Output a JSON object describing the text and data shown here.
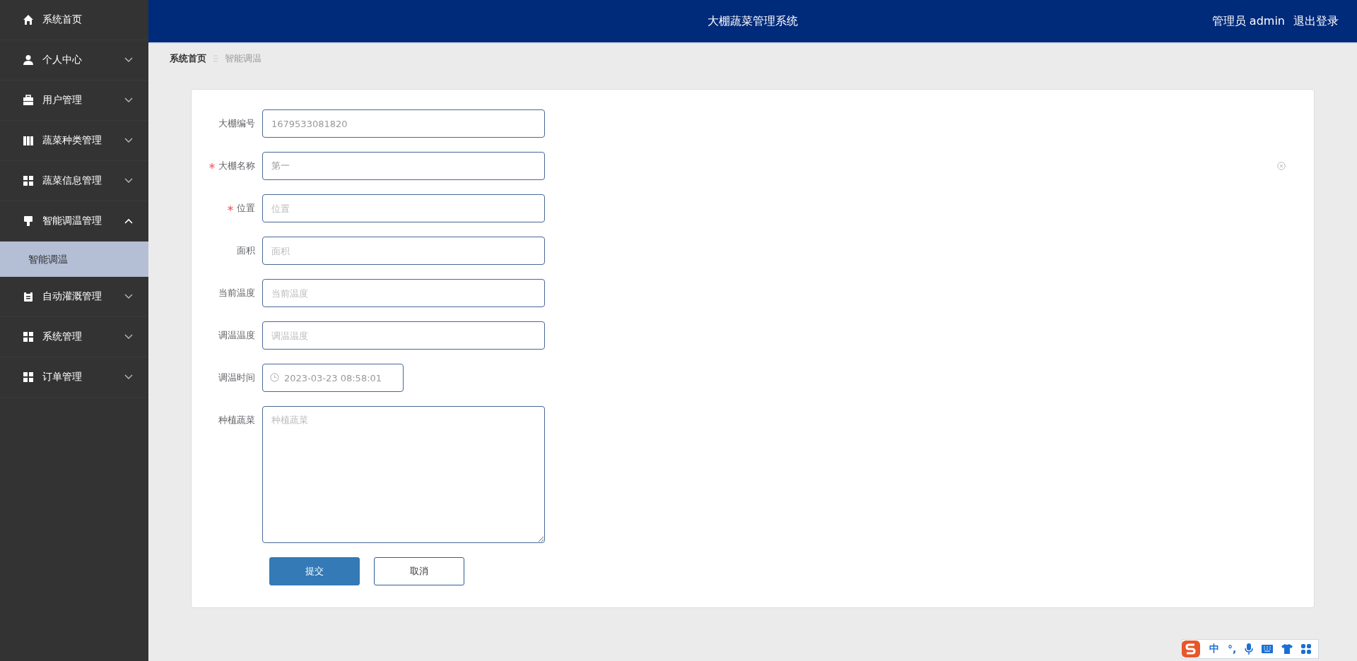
{
  "header": {
    "title": "大棚蔬菜管理系统",
    "user": "管理员 admin",
    "logout": "退出登录"
  },
  "sidebar": {
    "items": [
      {
        "label": "系统首页"
      },
      {
        "label": "个人中心",
        "expanded": false
      },
      {
        "label": "用户管理",
        "expanded": false
      },
      {
        "label": "蔬菜种类管理",
        "expanded": false
      },
      {
        "label": "蔬菜信息管理",
        "expanded": false
      },
      {
        "label": "智能调温管理",
        "expanded": true,
        "children": [
          {
            "label": "智能调温",
            "selected": true
          }
        ]
      },
      {
        "label": "自动灌溉管理",
        "expanded": false
      },
      {
        "label": "系统管理",
        "expanded": false
      },
      {
        "label": "订单管理",
        "expanded": false
      }
    ]
  },
  "breadcrumb": [
    {
      "label": "系统首页",
      "current": false
    },
    {
      "label": "智能调温",
      "current": true
    }
  ],
  "form": {
    "fields": [
      {
        "kind": "text",
        "label": "大棚编号",
        "required": false,
        "value": "1679533081820"
      },
      {
        "kind": "text",
        "label": "大棚名称",
        "required": true,
        "value": "第一",
        "clearable": true
      },
      {
        "kind": "text",
        "label": "位置",
        "required": true,
        "placeholder": "位置"
      },
      {
        "kind": "text",
        "label": "面积",
        "required": false,
        "placeholder": "面积"
      },
      {
        "kind": "text",
        "label": "当前温度",
        "required": false,
        "placeholder": "当前温度"
      },
      {
        "kind": "text",
        "label": "调温温度",
        "required": false,
        "placeholder": "调温温度"
      },
      {
        "kind": "datetime",
        "label": "调温时间",
        "required": false,
        "value": "2023-03-23 08:58:01"
      },
      {
        "kind": "textarea",
        "label": "种植蔬菜",
        "required": false,
        "placeholder": "种植蔬菜"
      }
    ],
    "buttons": [
      {
        "label": "提交",
        "primary": true
      },
      {
        "label": "取消",
        "primary": false
      }
    ]
  },
  "ime_toolbar": {
    "mode": "中",
    "punctuation": "°,"
  }
}
